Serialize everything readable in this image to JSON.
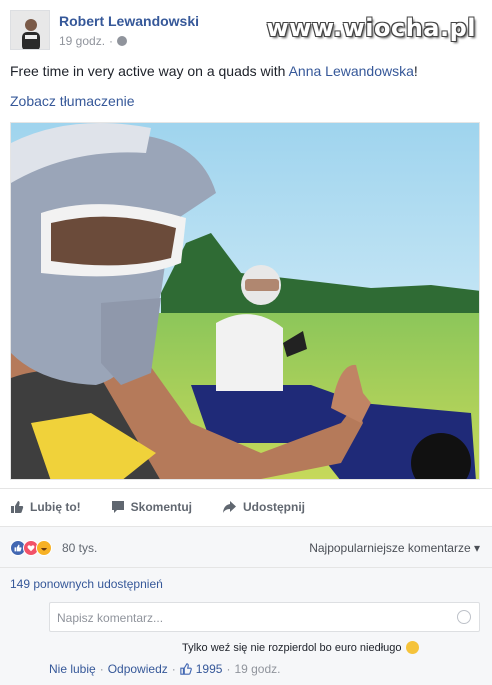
{
  "post": {
    "author": "Robert Lewandowski",
    "time": "19 godz.",
    "meta_separator": "·",
    "text_before": "Free time in very active way on a quads with ",
    "mention": "Anna Lewandowska",
    "text_after": "!",
    "translate_link": "Zobacz tłumaczenie"
  },
  "watermark": "www.wiocha.pl",
  "actions": {
    "like": "Lubię to!",
    "comment": "Skomentuj",
    "share": "Udostępnij"
  },
  "reactions": {
    "count": "80 tys.",
    "sort_label": "Najpopularniejsze komentarze",
    "sort_arrow": "▾"
  },
  "shares": "149 ponownych udostępnień",
  "comment_box": {
    "placeholder": "Napisz komentarz..."
  },
  "comment": {
    "text": "Tylko weź się nie rozpierdol bo euro niedługo",
    "unlike": "Nie lubię",
    "reply": "Odpowiedz",
    "likes": "1995",
    "time": "19 godz.",
    "separator": "·"
  },
  "colors": {
    "link": "#365899",
    "like_blue": "#4267b2",
    "love_red": "#f25268",
    "haha_yellow": "#f7b125"
  },
  "icons": [
    "globe-icon",
    "like-icon",
    "comment-icon",
    "share-icon",
    "love-icon",
    "haha-icon",
    "smiley-icon",
    "thumbs-up-icon"
  ]
}
